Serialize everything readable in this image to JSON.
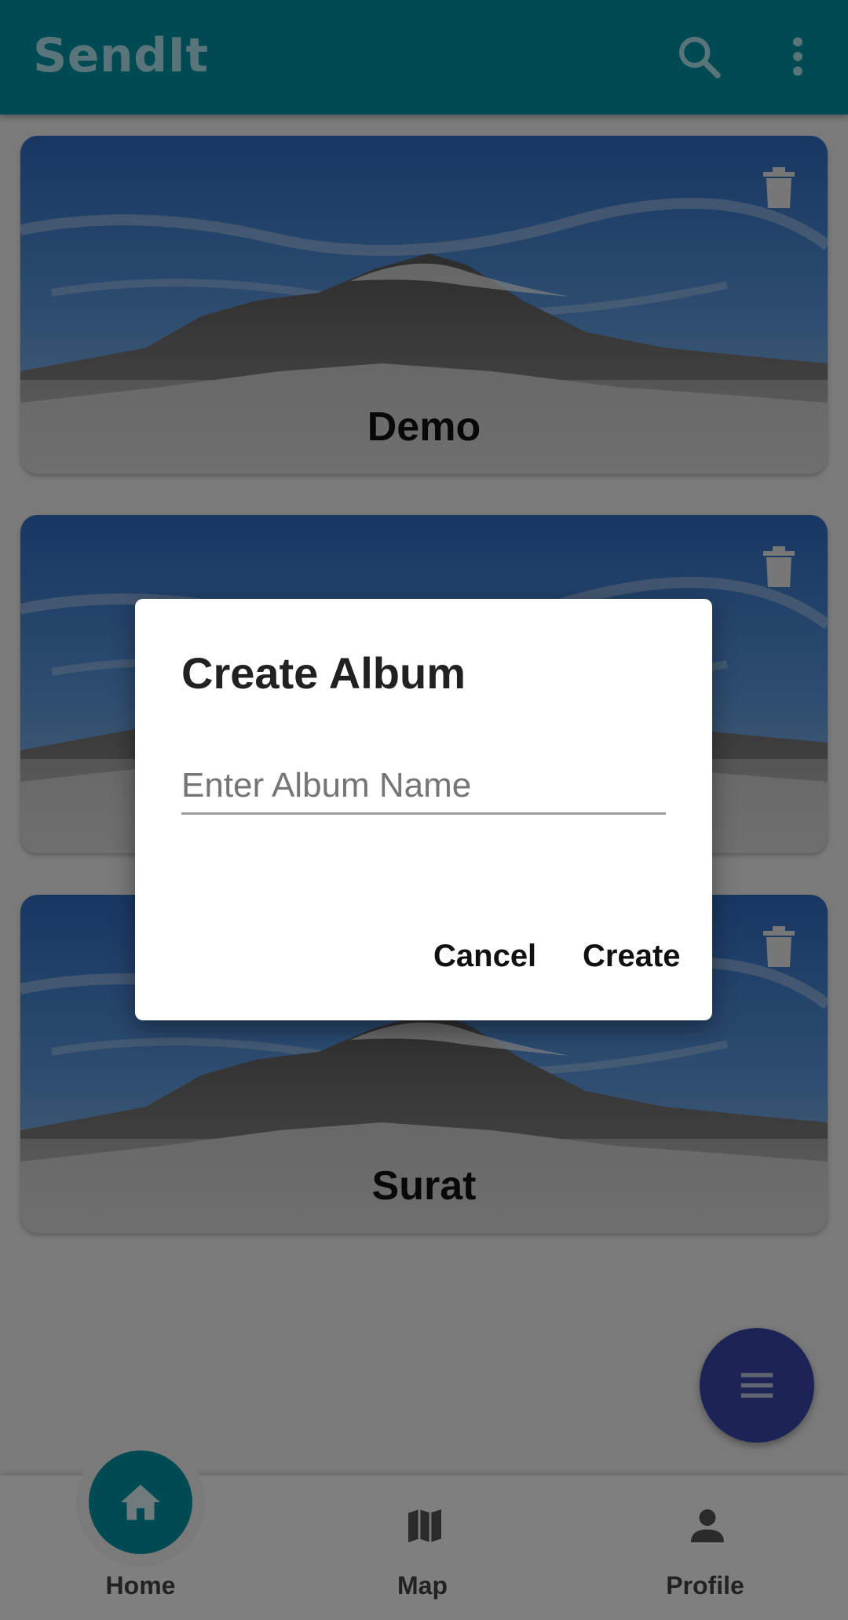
{
  "app": {
    "title": "SendIt"
  },
  "appbar": {
    "icons": [
      "search-icon",
      "more-vert-icon"
    ]
  },
  "albums": [
    {
      "name": "Demo",
      "action_icon": "trash-icon"
    },
    {
      "name": "",
      "action_icon": "trash-icon"
    },
    {
      "name": "Surat",
      "action_icon": "trash-icon"
    }
  ],
  "fab": {
    "icon": "menu-icon"
  },
  "bottom_nav": {
    "items": [
      {
        "label": "Home",
        "icon": "home-icon",
        "selected": true
      },
      {
        "label": "Map",
        "icon": "map-icon",
        "selected": false
      },
      {
        "label": "Profile",
        "icon": "person-icon",
        "selected": false
      }
    ]
  },
  "dialog": {
    "title": "Create Album",
    "input_placeholder": "Enter Album Name",
    "input_value": "",
    "cancel_label": "Cancel",
    "create_label": "Create"
  },
  "colors": {
    "primary": "#0097a7",
    "fab": "#3949ab",
    "title": "#b2ebf2"
  }
}
